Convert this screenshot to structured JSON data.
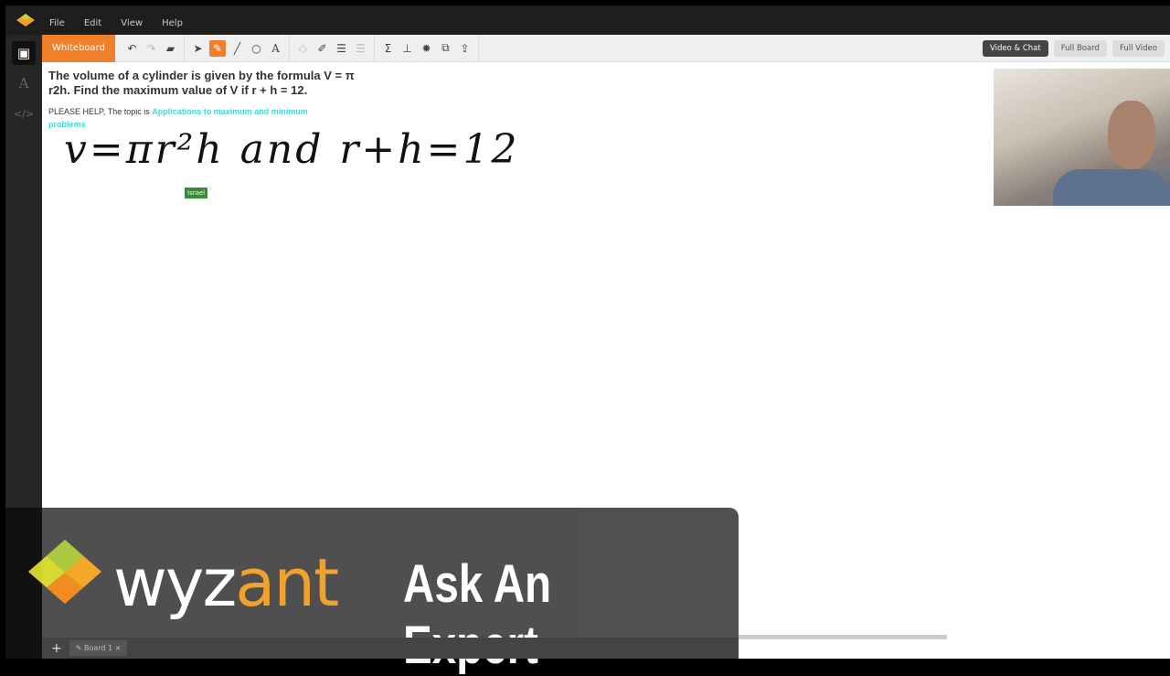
{
  "menu": {
    "items": [
      "File",
      "Edit",
      "View",
      "Help"
    ]
  },
  "toolbar": {
    "tab": "Whiteboard",
    "tools": [
      "undo-icon",
      "redo-icon",
      "eraser-icon",
      "select-icon",
      "pen-icon",
      "line-icon",
      "shape-icon",
      "text-icon",
      "fill-icon",
      "color-icon",
      "line-weight-icon",
      "line-style-icon",
      "sigma-icon",
      "graph-icon",
      "gear-icon",
      "layers-icon",
      "upload-icon"
    ]
  },
  "view_buttons": [
    "Video & Chat",
    "Full Board",
    "Full Video"
  ],
  "question": {
    "title": "The volume of a cylinder is given by the formula V = π r2h. Find the maximum value of V if r + h = 12.",
    "body": "PLEASE HELP, The topic is ",
    "topic": "Applications to maximum and minimum problems"
  },
  "handwriting": "v=πr²h  and r+h=12",
  "cursor_label": "Israel",
  "banner": {
    "brand_white": "wyz",
    "brand_orange": "ant",
    "tagline": "Ask An Expert"
  },
  "board_tabs": [
    "Board 1"
  ],
  "colors": {
    "accent": "#f07f2a",
    "topic": "#3dd6d0",
    "brand_orange": "#f0a02a"
  }
}
